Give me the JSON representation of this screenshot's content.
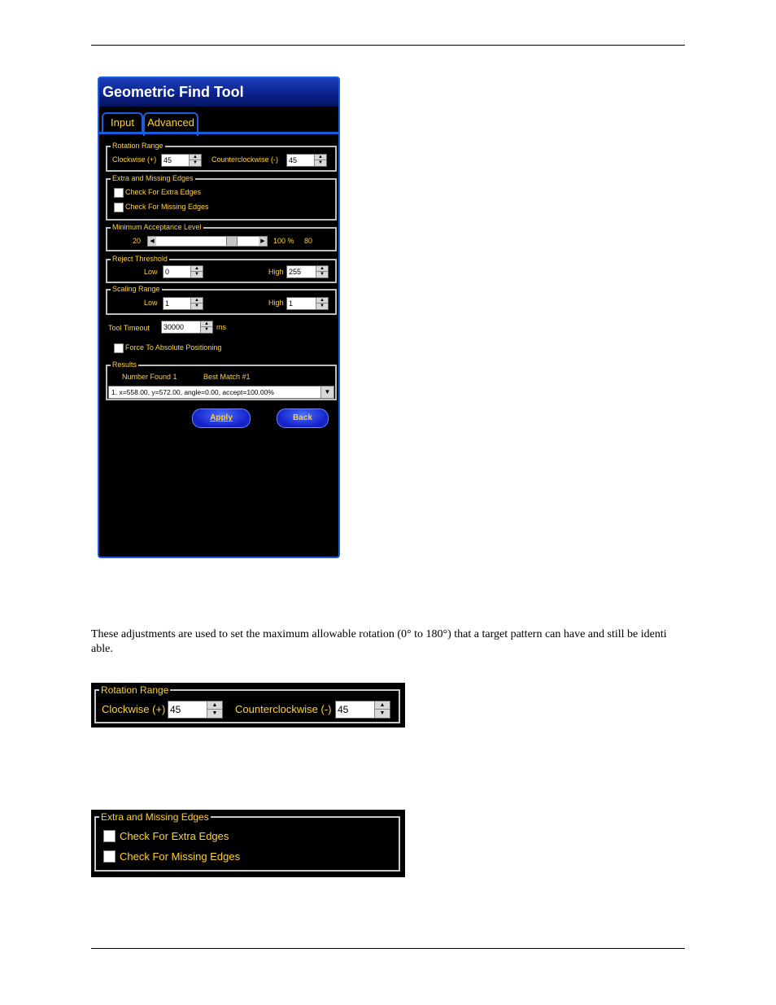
{
  "panel": {
    "title": "Geometric Find Tool",
    "tabs": {
      "input": "Input",
      "advanced": "Advanced"
    },
    "rotation": {
      "legend": "Rotation Range",
      "cw_label": "Clockwise (+)",
      "cw_value": "45",
      "ccw_label": "Counterclockwise (-)",
      "ccw_value": "45"
    },
    "edges": {
      "legend": "Extra and Missing Edges",
      "extra": "Check For Extra Edges",
      "missing": "Check For Missing Edges"
    },
    "acceptance": {
      "legend": "Minimum Acceptance Level",
      "min": "20",
      "max": "100 %",
      "value": "80",
      "fill_fraction": 0.75
    },
    "reject": {
      "legend": "Reject Threshold",
      "low_label": "Low",
      "low_value": "0",
      "high_label": "High",
      "high_value": "255"
    },
    "scaling": {
      "legend": "Scaling Range",
      "low_label": "Low",
      "low_value": "1",
      "high_label": "High",
      "high_value": "1"
    },
    "timeout": {
      "label": "Tool Timeout",
      "value": "30000",
      "unit": "ms"
    },
    "absolute": "Force To Absolute Positioning",
    "results": {
      "legend": "Results",
      "found": "Number Found  1",
      "best": "Best Match #1",
      "selected": "1. x=558.00, y=572.00, angle=0.00, accept=100.00%"
    },
    "apply": "Apply",
    "back": "Back"
  },
  "paragraph": "These adjustments are used to set the maximum allowable rotation (0° to 180°) that a target pattern can have and still be identi  able.",
  "crop_rotation": {
    "legend": "Rotation Range",
    "cw_label": "Clockwise (+)",
    "cw_value": "45",
    "ccw_label": "Counterclockwise (-)",
    "ccw_value": "45"
  },
  "crop_edges": {
    "legend": "Extra and Missing Edges",
    "extra": "Check For Extra Edges",
    "missing": "Check For Missing Edges"
  },
  "colors": {
    "accent": "#1a5ee0",
    "label": "#ffd23a",
    "title_bar": "#0b1f8a"
  }
}
